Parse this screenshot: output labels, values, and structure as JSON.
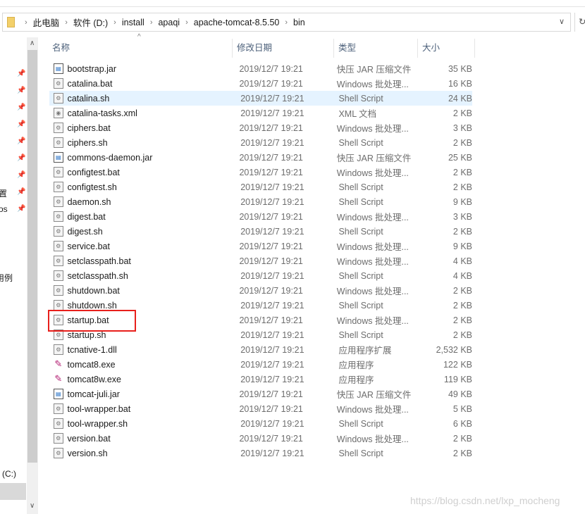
{
  "address": {
    "crumbs": [
      "此电脑",
      "软件 (D:)",
      "install",
      "apaqi",
      "apache-tomcat-8.5.50",
      "bin"
    ]
  },
  "nav": {
    "fragments": [
      "置",
      "os",
      "用例",
      "(C:)"
    ]
  },
  "columns": [
    "名称",
    "修改日期",
    "类型",
    "大小"
  ],
  "files": [
    {
      "name": "bootstrap.jar",
      "date": "2019/12/7 19:21",
      "type": "快压 JAR 压缩文件",
      "size": "35 KB",
      "icon": "jar"
    },
    {
      "name": "catalina.bat",
      "date": "2019/12/7 19:21",
      "type": "Windows 批处理...",
      "size": "16 KB",
      "icon": "script"
    },
    {
      "name": "catalina.sh",
      "date": "2019/12/7 19:21",
      "type": "Shell Script",
      "size": "24 KB",
      "icon": "script"
    },
    {
      "name": "catalina-tasks.xml",
      "date": "2019/12/7 19:21",
      "type": "XML 文档",
      "size": "2 KB",
      "icon": "xml"
    },
    {
      "name": "ciphers.bat",
      "date": "2019/12/7 19:21",
      "type": "Windows 批处理...",
      "size": "3 KB",
      "icon": "script"
    },
    {
      "name": "ciphers.sh",
      "date": "2019/12/7 19:21",
      "type": "Shell Script",
      "size": "2 KB",
      "icon": "script"
    },
    {
      "name": "commons-daemon.jar",
      "date": "2019/12/7 19:21",
      "type": "快压 JAR 压缩文件",
      "size": "25 KB",
      "icon": "jar"
    },
    {
      "name": "configtest.bat",
      "date": "2019/12/7 19:21",
      "type": "Windows 批处理...",
      "size": "2 KB",
      "icon": "script"
    },
    {
      "name": "configtest.sh",
      "date": "2019/12/7 19:21",
      "type": "Shell Script",
      "size": "2 KB",
      "icon": "script"
    },
    {
      "name": "daemon.sh",
      "date": "2019/12/7 19:21",
      "type": "Shell Script",
      "size": "9 KB",
      "icon": "script"
    },
    {
      "name": "digest.bat",
      "date": "2019/12/7 19:21",
      "type": "Windows 批处理...",
      "size": "3 KB",
      "icon": "script"
    },
    {
      "name": "digest.sh",
      "date": "2019/12/7 19:21",
      "type": "Shell Script",
      "size": "2 KB",
      "icon": "script"
    },
    {
      "name": "service.bat",
      "date": "2019/12/7 19:21",
      "type": "Windows 批处理...",
      "size": "9 KB",
      "icon": "script"
    },
    {
      "name": "setclasspath.bat",
      "date": "2019/12/7 19:21",
      "type": "Windows 批处理...",
      "size": "4 KB",
      "icon": "script"
    },
    {
      "name": "setclasspath.sh",
      "date": "2019/12/7 19:21",
      "type": "Shell Script",
      "size": "4 KB",
      "icon": "script"
    },
    {
      "name": "shutdown.bat",
      "date": "2019/12/7 19:21",
      "type": "Windows 批处理...",
      "size": "2 KB",
      "icon": "script"
    },
    {
      "name": "shutdown.sh",
      "date": "2019/12/7 19:21",
      "type": "Shell Script",
      "size": "2 KB",
      "icon": "script"
    },
    {
      "name": "startup.bat",
      "date": "2019/12/7 19:21",
      "type": "Windows 批处理...",
      "size": "2 KB",
      "icon": "script"
    },
    {
      "name": "startup.sh",
      "date": "2019/12/7 19:21",
      "type": "Shell Script",
      "size": "2 KB",
      "icon": "script"
    },
    {
      "name": "tcnative-1.dll",
      "date": "2019/12/7 19:21",
      "type": "应用程序扩展",
      "size": "2,532 KB",
      "icon": "dll"
    },
    {
      "name": "tomcat8.exe",
      "date": "2019/12/7 19:21",
      "type": "应用程序",
      "size": "122 KB",
      "icon": "exe"
    },
    {
      "name": "tomcat8w.exe",
      "date": "2019/12/7 19:21",
      "type": "应用程序",
      "size": "119 KB",
      "icon": "exe"
    },
    {
      "name": "tomcat-juli.jar",
      "date": "2019/12/7 19:21",
      "type": "快压 JAR 压缩文件",
      "size": "49 KB",
      "icon": "jar"
    },
    {
      "name": "tool-wrapper.bat",
      "date": "2019/12/7 19:21",
      "type": "Windows 批处理...",
      "size": "5 KB",
      "icon": "script"
    },
    {
      "name": "tool-wrapper.sh",
      "date": "2019/12/7 19:21",
      "type": "Shell Script",
      "size": "6 KB",
      "icon": "script"
    },
    {
      "name": "version.bat",
      "date": "2019/12/7 19:21",
      "type": "Windows 批处理...",
      "size": "2 KB",
      "icon": "script"
    },
    {
      "name": "version.sh",
      "date": "2019/12/7 19:21",
      "type": "Shell Script",
      "size": "2 KB",
      "icon": "script"
    }
  ],
  "hovered_index": 2,
  "highlighted_file": "startup.bat",
  "watermark": "https://blog.csdn.net/lxp_mocheng"
}
